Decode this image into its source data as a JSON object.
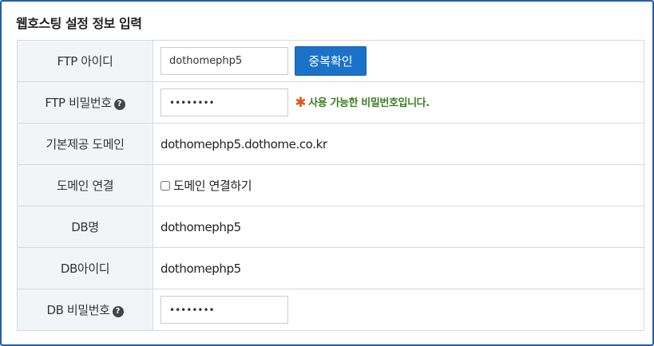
{
  "title": "웹호스팅 설정 정보 입력",
  "rows": {
    "ftp_id": {
      "label": "FTP 아이디",
      "value": "dothomephp5",
      "button": "중복확인"
    },
    "ftp_pw": {
      "label": "FTP 비밀번호",
      "help_icon": "help-icon",
      "value": "••••••••",
      "message_mark": "✱",
      "message": "사용 가능한 비밀번호입니다."
    },
    "domain": {
      "label": "기본제공 도메인",
      "value": "dothomephp5.dothome.co.kr"
    },
    "domain_connect": {
      "label": "도메인 연결",
      "checkbox_label": "도메인 연결하기",
      "checked": false
    },
    "db_name": {
      "label": "DB명",
      "value": "dothomephp5"
    },
    "db_id": {
      "label": "DB아이디",
      "value": "dothomephp5"
    },
    "db_pw": {
      "label": "DB 비밀번호",
      "help_icon": "help-icon",
      "value": "••••••••"
    }
  },
  "colors": {
    "frame_border": "#1f5fae",
    "button": "#1b73c9",
    "success_text": "#3b7f22",
    "asterisk": "#e2571b",
    "label_bg": "#f2f5f8"
  }
}
